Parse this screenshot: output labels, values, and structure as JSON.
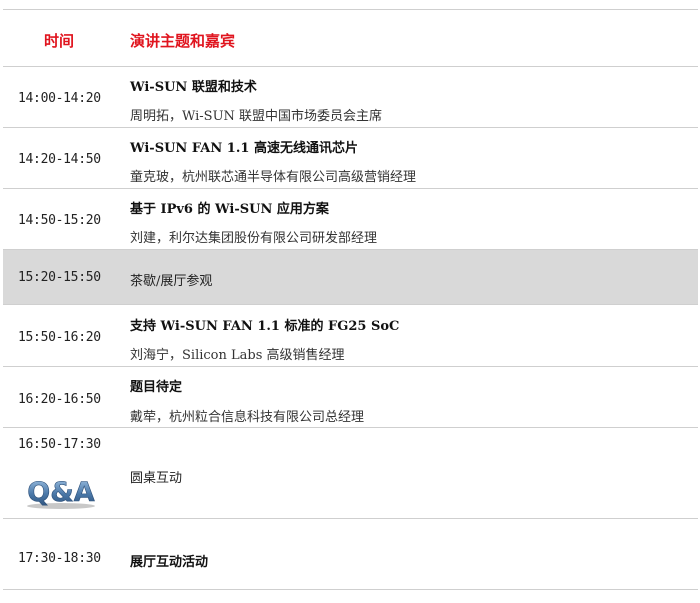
{
  "header": {
    "time_label": "时间",
    "topic_label": "演讲主题和嘉宾"
  },
  "sessions": [
    {
      "time": "14:00-14:20",
      "title": "Wi-SUN 联盟和技术",
      "speaker": "周明拓，Wi-SUN 联盟中国市场委员会主席"
    },
    {
      "time": "14:20-14:50",
      "title": "Wi-SUN FAN 1.1 高速无线通讯芯片",
      "speaker": "童克玻，杭州联芯通半导体有限公司高级营销经理"
    },
    {
      "time": "14:50-15:20",
      "title": "基于 IPv6 的 Wi-SUN 应用方案",
      "speaker": "刘建，利尔达集团股份有限公司研发部经理"
    },
    {
      "time": "15:20-15:50",
      "title": "茶歇/展厅参观"
    },
    {
      "time": "15:50-16:20",
      "title": "支持 Wi-SUN FAN 1.1 标准的  FG25 SoC",
      "speaker": "刘海宁，Silicon Labs 高级销售经理"
    },
    {
      "time": "16:20-16:50",
      "title": "题目待定",
      "speaker": "戴荦，杭州粒合信息科技有限公司总经理"
    },
    {
      "time": "16:50-17:30",
      "title": "圆桌互动",
      "logo_text": "Q&A"
    },
    {
      "time": "17:30-18:30",
      "title": "展厅互动活动"
    }
  ],
  "colors": {
    "header_red": "#e0141e",
    "shaded_row": "#d9d9d9",
    "rule": "#cfcfcf",
    "qa_blue": "#4a78a8"
  },
  "icons": {
    "qa": "qa-logo-icon"
  }
}
